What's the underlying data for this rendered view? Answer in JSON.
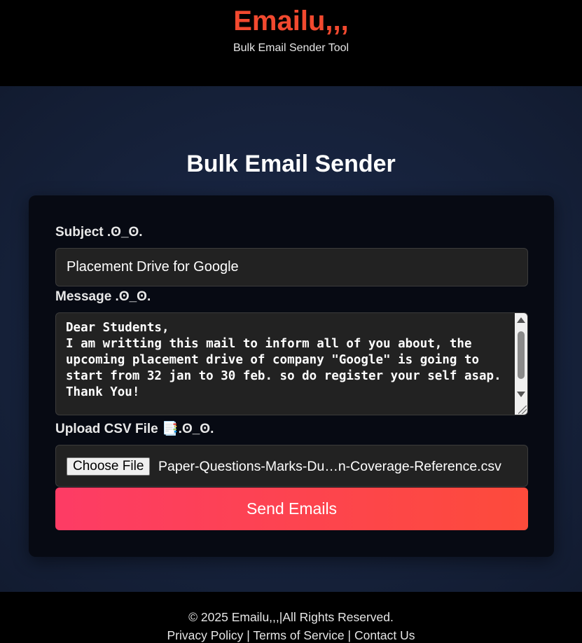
{
  "header": {
    "brand": "Emailu,,,",
    "tagline": "Bulk Email Sender Tool"
  },
  "main": {
    "title": "Bulk Email Sender"
  },
  "form": {
    "subject_label": "Subject .ʘ_ʘ.",
    "subject_value": "Placement Drive for Google",
    "message_label": "Message .ʘ_ʘ.",
    "message_value": "Dear Students,\nI am writting this mail to inform all of you about, the upcoming placement drive of company \"Google\" is going to start from 32 jan to 30 feb. so do register your self asap.\nThank You!",
    "upload_label": "Upload CSV File 📑.ʘ_ʘ.",
    "choose_file_label": "Choose File",
    "file_name": "Paper-Questions-Marks-Du…n-Coverage-Reference.csv",
    "send_label": "Send Emails"
  },
  "footer": {
    "copyright": "© 2025 Emailu,,,|All Rights Reserved.",
    "links": [
      "Privacy Policy",
      "Terms of Service",
      "Contact Us"
    ],
    "separator": "|"
  },
  "colors": {
    "brand": "#f2492f",
    "accent_start": "#fd3c65",
    "accent_end": "#fd4b3b"
  }
}
